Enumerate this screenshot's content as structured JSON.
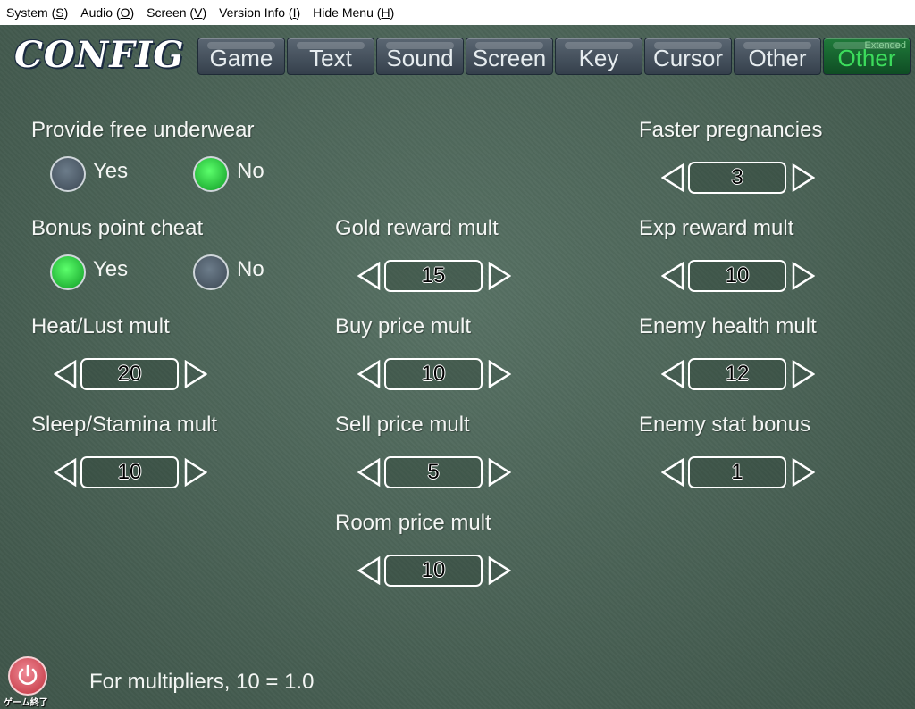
{
  "menubar": [
    {
      "label": "System (",
      "key": "S",
      "end": ")"
    },
    {
      "label": "Audio (",
      "key": "O",
      "end": ")"
    },
    {
      "label": "Screen (",
      "key": "V",
      "end": ")"
    },
    {
      "label": "Version Info (",
      "key": "I",
      "end": ")"
    },
    {
      "label": "Hide Menu (",
      "key": "H",
      "end": ")"
    }
  ],
  "logo": "CONFIG",
  "tabs": [
    {
      "label": "Game"
    },
    {
      "label": "Text"
    },
    {
      "label": "Sound"
    },
    {
      "label": "Screen"
    },
    {
      "label": "Key"
    },
    {
      "label": "Cursor"
    },
    {
      "label": "Other"
    },
    {
      "label": "Other",
      "sublabel": "Extended",
      "active": true
    }
  ],
  "toggles": {
    "underwear": {
      "label": "Provide free underwear",
      "yes": "Yes",
      "no": "No",
      "selected": "No"
    },
    "bonus": {
      "label": "Bonus point cheat",
      "yes": "Yes",
      "no": "No",
      "selected": "Yes"
    }
  },
  "steppers": {
    "faster_preg": {
      "label": "Faster pregnancies",
      "value": "3"
    },
    "gold": {
      "label": "Gold reward mult",
      "value": "15"
    },
    "exp": {
      "label": "Exp reward mult",
      "value": "10"
    },
    "heat": {
      "label": "Heat/Lust mult",
      "value": "20"
    },
    "buy": {
      "label": "Buy price mult",
      "value": "10"
    },
    "enemy_hp": {
      "label": "Enemy health mult",
      "value": "12"
    },
    "sleep": {
      "label": "Sleep/Stamina mult",
      "value": "10"
    },
    "sell": {
      "label": "Sell price mult",
      "value": "5"
    },
    "enemy_stat": {
      "label": "Enemy stat bonus",
      "value": "1"
    },
    "room": {
      "label": "Room price mult",
      "value": "10"
    }
  },
  "footer": {
    "quit_caption": "ゲーム終了",
    "note": "For multipliers, 10 = 1.0"
  },
  "colors": {
    "active_tab": "#0f4d24",
    "radio_on": "#18c830",
    "background": "#4d685a"
  }
}
